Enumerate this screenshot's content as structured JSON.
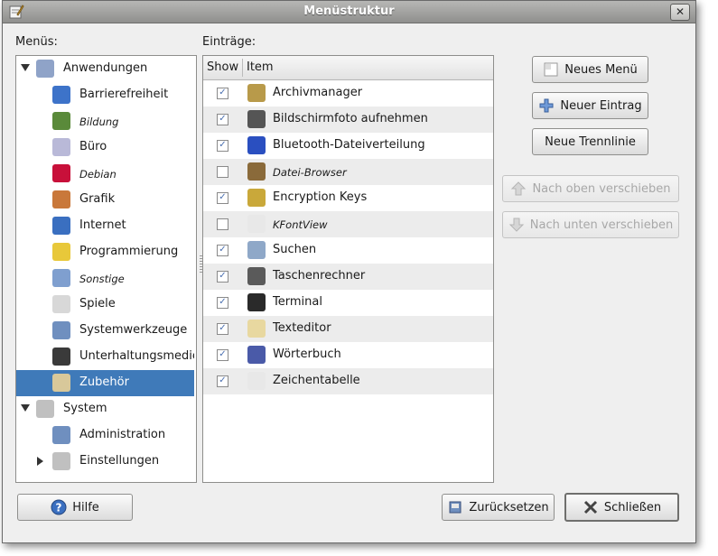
{
  "window": {
    "title": "Menüstruktur",
    "close_glyph": "✕"
  },
  "labels": {
    "menus": "Menüs:",
    "entries": "Einträge:"
  },
  "tree": [
    {
      "label": "Anwendungen",
      "icon": "applications-icon",
      "level": 0,
      "expander": "down",
      "italic": false,
      "color": "#8fa3c8"
    },
    {
      "label": "Barrierefreiheit",
      "icon": "accessibility-icon",
      "level": 1,
      "italic": false,
      "color": "#3d73c9"
    },
    {
      "label": "Bildung",
      "icon": "education-icon",
      "level": 1,
      "italic": true,
      "color": "#5a8a3a"
    },
    {
      "label": "Büro",
      "icon": "office-icon",
      "level": 1,
      "italic": false,
      "color": "#b9b9d8"
    },
    {
      "label": "Debian",
      "icon": "debian-icon",
      "level": 1,
      "italic": true,
      "color": "#c8103a"
    },
    {
      "label": "Grafik",
      "icon": "graphics-icon",
      "level": 1,
      "italic": false,
      "color": "#c9783a"
    },
    {
      "label": "Internet",
      "icon": "internet-icon",
      "level": 1,
      "italic": false,
      "color": "#3a6fc0"
    },
    {
      "label": "Programmierung",
      "icon": "programming-icon",
      "level": 1,
      "italic": false,
      "color": "#e8c83a"
    },
    {
      "label": "Sonstige",
      "icon": "other-folder-icon",
      "level": 1,
      "italic": true,
      "color": "#7f9fcf"
    },
    {
      "label": "Spiele",
      "icon": "games-icon",
      "level": 1,
      "italic": false,
      "color": "#d8d8d8"
    },
    {
      "label": "Systemwerkzeuge",
      "icon": "system-tools-icon",
      "level": 1,
      "italic": false,
      "color": "#6f8fbf"
    },
    {
      "label": "Unterhaltungsmedien",
      "icon": "multimedia-icon",
      "level": 1,
      "italic": false,
      "color": "#3a3a3a"
    },
    {
      "label": "Zubehör",
      "icon": "accessories-icon",
      "level": 1,
      "italic": false,
      "selected": true,
      "color": "#d8c89a"
    },
    {
      "label": "System",
      "icon": "system-icon",
      "level": 0,
      "expander": "down",
      "italic": false,
      "color": "#c0c0c0"
    },
    {
      "label": "Administration",
      "icon": "administration-icon",
      "level": 1,
      "italic": false,
      "color": "#6f8fbf"
    },
    {
      "label": "Einstellungen",
      "icon": "preferences-icon",
      "level": 1,
      "expander": "right",
      "italic": false,
      "color": "#c0c0c0"
    }
  ],
  "grid": {
    "headers": {
      "show": "Show",
      "item": "Item"
    },
    "rows": [
      {
        "label": "Archivmanager",
        "checked": true,
        "icon": "archive-manager-icon",
        "italic": false,
        "color": "#b89a4a"
      },
      {
        "label": "Bildschirmfoto aufnehmen",
        "checked": true,
        "icon": "screenshot-icon",
        "italic": false,
        "color": "#555555"
      },
      {
        "label": "Bluetooth-Dateiverteilung",
        "checked": true,
        "icon": "bluetooth-icon",
        "italic": false,
        "color": "#2a4fc0"
      },
      {
        "label": "Datei-Browser",
        "checked": false,
        "icon": "file-browser-icon",
        "italic": true,
        "color": "#8a6a3a"
      },
      {
        "label": "Encryption Keys",
        "checked": true,
        "icon": "keys-icon",
        "italic": false,
        "color": "#c9a83a"
      },
      {
        "label": "KFontView",
        "checked": false,
        "icon": "font-viewer-icon",
        "italic": true,
        "color": "#e8e8e8"
      },
      {
        "label": "Suchen",
        "checked": true,
        "icon": "search-icon",
        "italic": false,
        "color": "#8fa8c8"
      },
      {
        "label": "Taschenrechner",
        "checked": true,
        "icon": "calculator-icon",
        "italic": false,
        "color": "#5a5a5a"
      },
      {
        "label": "Terminal",
        "checked": true,
        "icon": "terminal-icon",
        "italic": false,
        "color": "#2a2a2a"
      },
      {
        "label": "Texteditor",
        "checked": true,
        "icon": "text-editor-icon",
        "italic": false,
        "color": "#e8d8a0"
      },
      {
        "label": "Wörterbuch",
        "checked": true,
        "icon": "dictionary-icon",
        "italic": false,
        "color": "#4a5aa8"
      },
      {
        "label": "Zeichentabelle",
        "checked": true,
        "icon": "character-map-icon",
        "italic": false,
        "color": "#e8e8e8"
      }
    ]
  },
  "buttons": {
    "new_menu": "Neues Menü",
    "new_item": "Neuer Eintrag",
    "new_separator": "Neue Trennlinie",
    "move_up": "Nach oben verschieben",
    "move_down": "Nach unten verschieben",
    "help": "Hilfe",
    "revert": "Zurücksetzen",
    "close": "Schließen"
  },
  "check_glyph": "✓"
}
